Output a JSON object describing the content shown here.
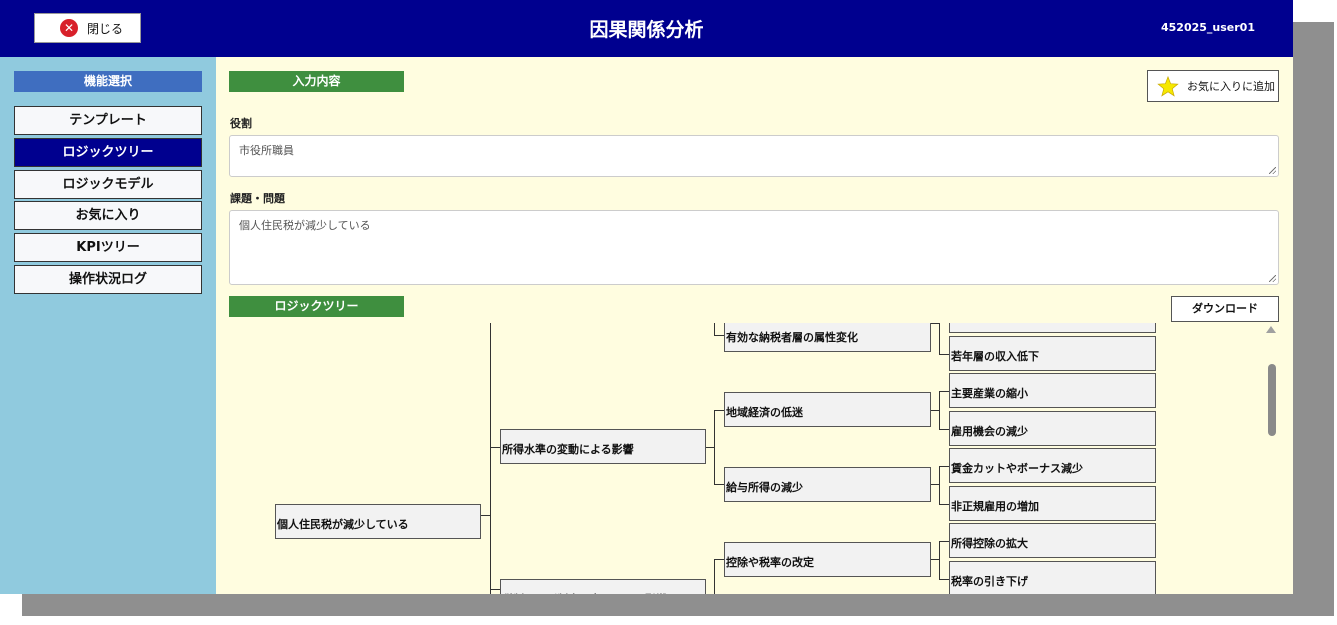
{
  "header": {
    "close_label": "閉じる",
    "title": "因果関係分析",
    "user": "452025_user01"
  },
  "sidebar": {
    "heading": "機能選択",
    "items": [
      {
        "label": "テンプレート",
        "active": false
      },
      {
        "label": "ロジックツリー",
        "active": true
      },
      {
        "label": "ロジックモデル",
        "active": false
      },
      {
        "label": "お気に入り",
        "active": false
      },
      {
        "label": "KPIツリー",
        "active": false
      },
      {
        "label": "操作状況ログ",
        "active": false
      }
    ]
  },
  "input_section": {
    "label": "入力内容",
    "favorite_label": "お気に入りに追加",
    "role_label": "役割",
    "role_value": "市役所職員",
    "issue_label": "課題・問題",
    "issue_value": "個人住民税が減少している"
  },
  "tree_section": {
    "label": "ロジックツリー",
    "download_label": "ダウンロード",
    "nodes": {
      "root": "個人住民税が減少している",
      "l1_income": "所得水準の変動による影響",
      "l1_tax": "税制および制度の変更による影響",
      "l2_attr": "有効な納税者層の属性変化",
      "l2_regional": "地域経済の低迷",
      "l2_salary": "給与所得の減少",
      "l2_deduction": "控除や税率の改定",
      "l3_young": "若年層の収入低下",
      "l3_industry": "主要産業の縮小",
      "l3_jobs": "雇用機会の減少",
      "l3_wagecut": "賃金カットやボーナス減少",
      "l3_irregular": "非正規雇用の増加",
      "l3_deduction_expand": "所得控除の拡大",
      "l3_rate_cut": "税率の引き下げ"
    }
  },
  "colors": {
    "header_bg": "#00008f",
    "sidebar_bg": "#90cade",
    "content_bg": "#fffde0",
    "section_label_bg": "#3f8f3f",
    "sidebar_heading_bg": "#3f6ec0"
  }
}
